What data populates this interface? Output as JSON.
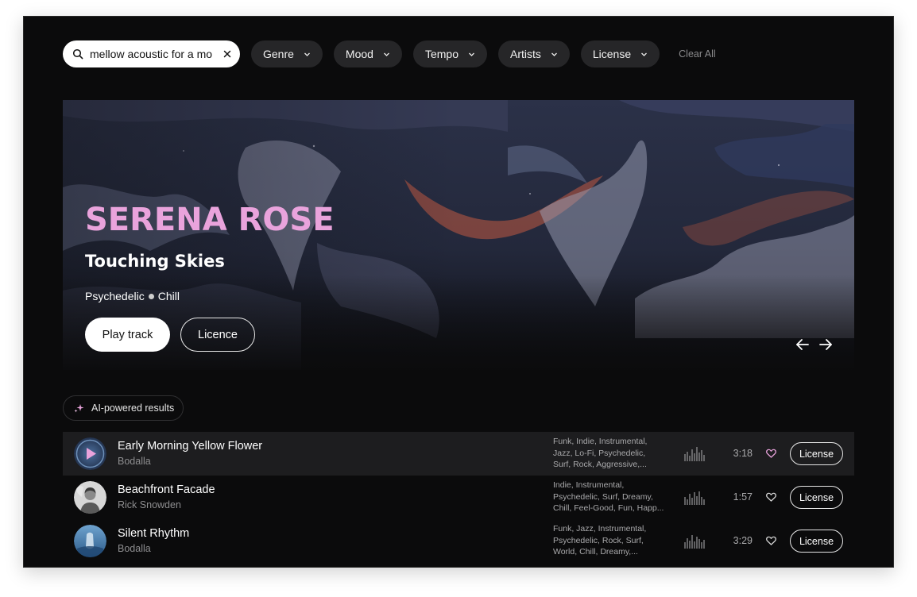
{
  "search": {
    "value": "mellow acoustic for a mo",
    "placeholder": "Search"
  },
  "filters": [
    {
      "label": "Genre"
    },
    {
      "label": "Mood"
    },
    {
      "label": "Tempo"
    },
    {
      "label": "Artists"
    },
    {
      "label": "License"
    }
  ],
  "clear_all_label": "Clear All",
  "hero": {
    "artist": "SERENA ROSE",
    "title": "Touching Skies",
    "tags": [
      "Psychedelic",
      "Chill"
    ],
    "play_label": "Play track",
    "licence_label": "Licence"
  },
  "ai_badge_label": "AI-powered results",
  "tracks": [
    {
      "title": "Early Morning Yellow Flower",
      "artist": "Bodalla",
      "tags": "Funk, Indie, Instrumental,\nJazz, Lo-Fi, Psychedelic,\nSurf, Rock, Aggressive,...",
      "duration": "3:18",
      "license_label": "License",
      "playing": true
    },
    {
      "title": "Beachfront Facade",
      "artist": "Rick Snowden",
      "tags": "Indie, Instrumental,\nPsychedelic, Surf, Dreamy,\nChill, Feel-Good, Fun, Happ...",
      "duration": "1:57",
      "license_label": "License",
      "playing": false
    },
    {
      "title": "Silent Rhythm",
      "artist": "Bodalla",
      "tags": "Funk, Jazz, Instrumental,\nPsychedelic, Rock, Surf,\nWorld, Chill, Dreamy,...",
      "duration": "3:29",
      "license_label": "License",
      "playing": false
    }
  ],
  "colors": {
    "background": "#0b0b0c",
    "accent_pink": "#e9a3dc",
    "chip_bg": "#262628",
    "active_row": "#1d1d1f"
  },
  "icons": {
    "search": "search-icon",
    "clear": "close-icon",
    "chevron": "chevron-down-icon",
    "prev": "arrow-left-icon",
    "next": "arrow-right-icon",
    "sparkle": "sparkle-icon",
    "waveform": "waveform-icon",
    "heart": "heart-icon",
    "play": "play-icon"
  }
}
